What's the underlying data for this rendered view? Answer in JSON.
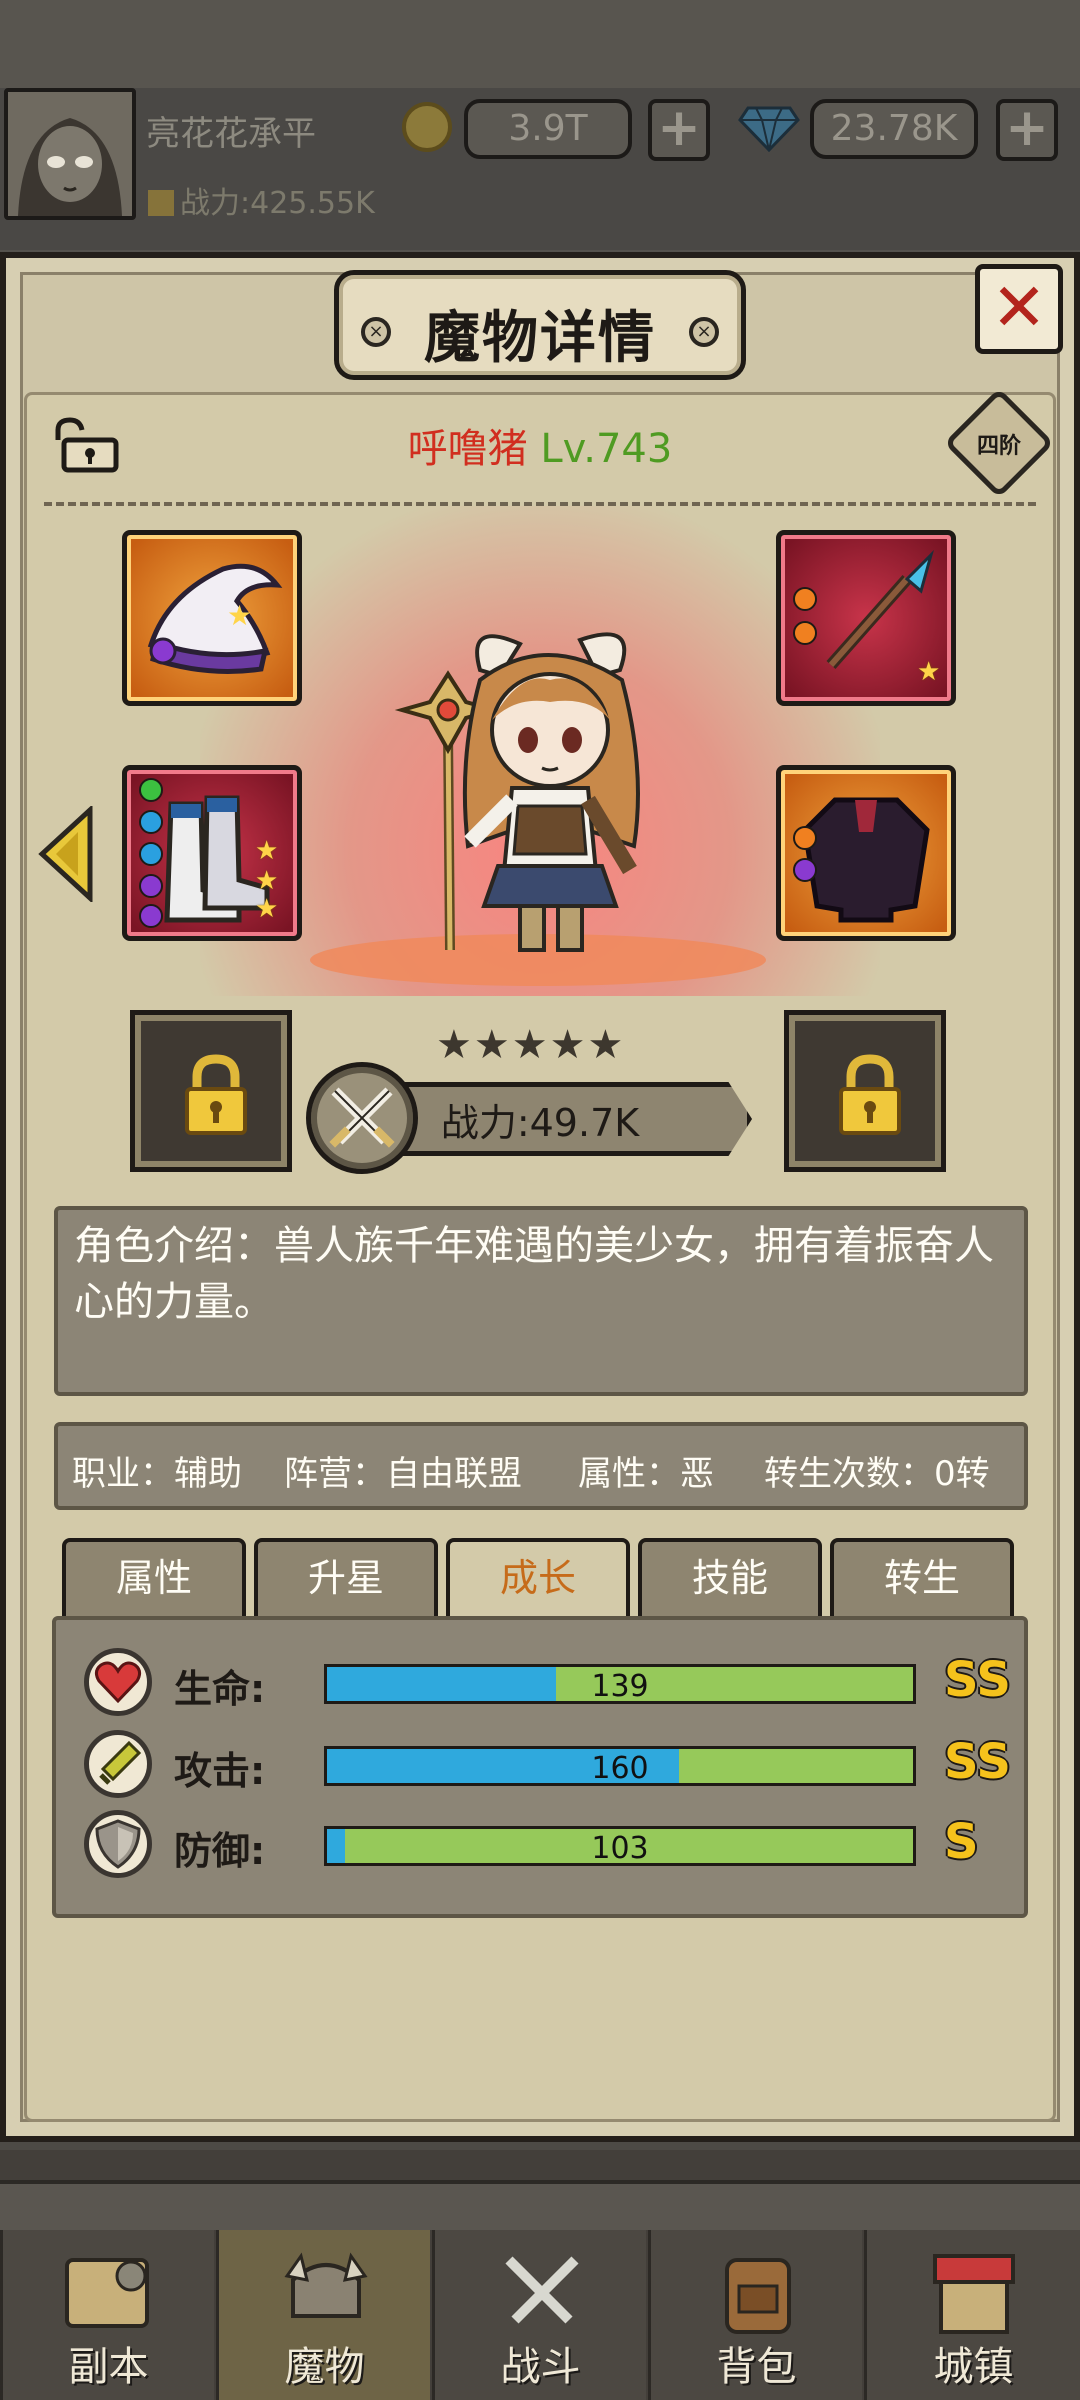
{
  "player": {
    "name": "亮花花承平",
    "power": "战力:425.55K"
  },
  "resources": {
    "gold": "3.9T",
    "gems": "23.78K",
    "plus": "+"
  },
  "dialog": {
    "title": "魔物详情",
    "close": "✕"
  },
  "monster": {
    "name": "呼噜猪",
    "level": "Lv.743",
    "rank": "四阶",
    "stars": 5,
    "power": "战力:49.7K",
    "intro": "角色介绍：兽人族千年难遇的美少女，拥有着振奋人心的力量。"
  },
  "info": {
    "job": "职业：辅助",
    "camp": "阵营：自由联盟",
    "attr": "属性：恶",
    "rebirth": "转生次数：0转"
  },
  "tabs": [
    {
      "label": "属性"
    },
    {
      "label": "升星"
    },
    {
      "label": "成长"
    },
    {
      "label": "技能"
    },
    {
      "label": "转生"
    }
  ],
  "active_tab": "成长",
  "stats": [
    {
      "label": "生命:",
      "value": "139",
      "grade": "SS",
      "fill": 0.39
    },
    {
      "label": "攻击:",
      "value": "160",
      "grade": "SS",
      "fill": 0.6
    },
    {
      "label": "防御:",
      "value": "103",
      "grade": "S",
      "fill": 0.03
    }
  ],
  "equipment": [
    {
      "slot": "hat",
      "frame": "orange",
      "icon": "wizard-hat-icon"
    },
    {
      "slot": "weapon",
      "frame": "red",
      "icon": "spear-icon"
    },
    {
      "slot": "boots",
      "frame": "red",
      "icon": "boots-icon"
    },
    {
      "slot": "armor",
      "frame": "orange",
      "icon": "coat-icon"
    }
  ],
  "bottom_nav": [
    {
      "label": "副本",
      "icon": "map-icon"
    },
    {
      "label": "魔物",
      "icon": "monster-icon"
    },
    {
      "label": "战斗",
      "icon": "swords-icon"
    },
    {
      "label": "背包",
      "icon": "backpack-icon"
    },
    {
      "label": "城镇",
      "icon": "town-icon"
    }
  ],
  "colors": {
    "name_red": "#d12e1f",
    "level_green": "#4f9b22",
    "bar_blue": "#2fa9dd",
    "bar_green": "#96c95a",
    "grade_gold": "#f5c21c"
  }
}
